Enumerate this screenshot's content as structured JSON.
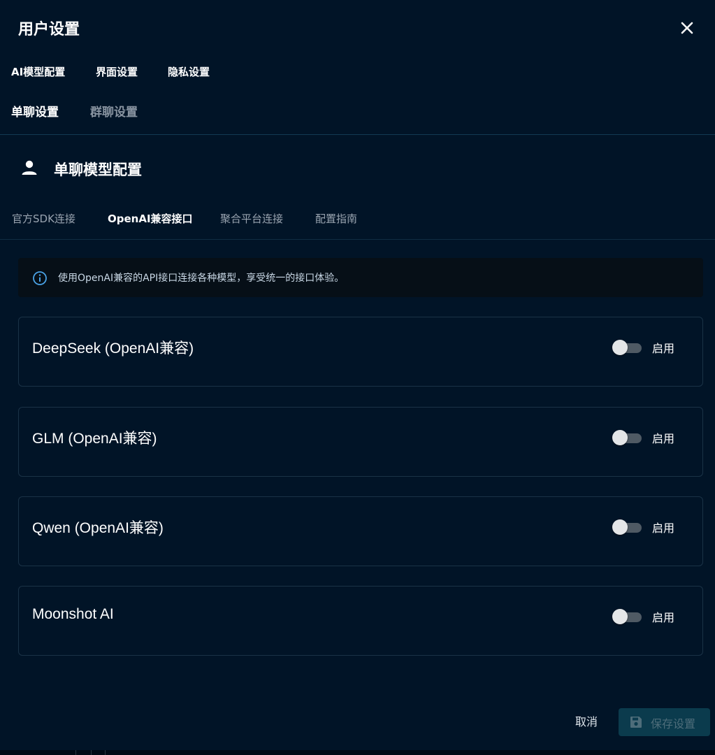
{
  "dialog": {
    "title": "用户设置"
  },
  "top_tabs": [
    {
      "label": "AI模型配置"
    },
    {
      "label": "界面设置"
    },
    {
      "label": "隐私设置"
    }
  ],
  "chat_tabs": [
    {
      "label": "单聊设置",
      "active": true
    },
    {
      "label": "群聊设置",
      "active": false
    }
  ],
  "section": {
    "title": "单聊模型配置",
    "icon": "person-icon"
  },
  "sub_tabs": [
    {
      "label": "官方SDK连接",
      "active": false
    },
    {
      "label": "OpenAI兼容接口",
      "active": true
    },
    {
      "label": "聚合平台连接",
      "active": false
    },
    {
      "label": "配置指南",
      "active": false
    }
  ],
  "info": {
    "icon": "info-icon",
    "text": "使用OpenAI兼容的API接口连接各种模型，享受统一的接口体验。"
  },
  "providers": [
    {
      "name": "DeepSeek (OpenAI兼容)",
      "enabled": false,
      "toggle_label": "启用"
    },
    {
      "name": "GLM (OpenAI兼容)",
      "enabled": false,
      "toggle_label": "启用"
    },
    {
      "name": "Qwen (OpenAI兼容)",
      "enabled": false,
      "toggle_label": "启用"
    },
    {
      "name": "Moonshot AI",
      "enabled": false,
      "toggle_label": "启用"
    }
  ],
  "footer": {
    "cancel_label": "取消",
    "save_label": "保存设置",
    "save_icon": "save-icon"
  },
  "colors": {
    "background": "#011427",
    "accent_disabled": "#0b3b4d",
    "toggle_off_track": "#4f5a64",
    "info_icon": "#4aa3e6"
  }
}
